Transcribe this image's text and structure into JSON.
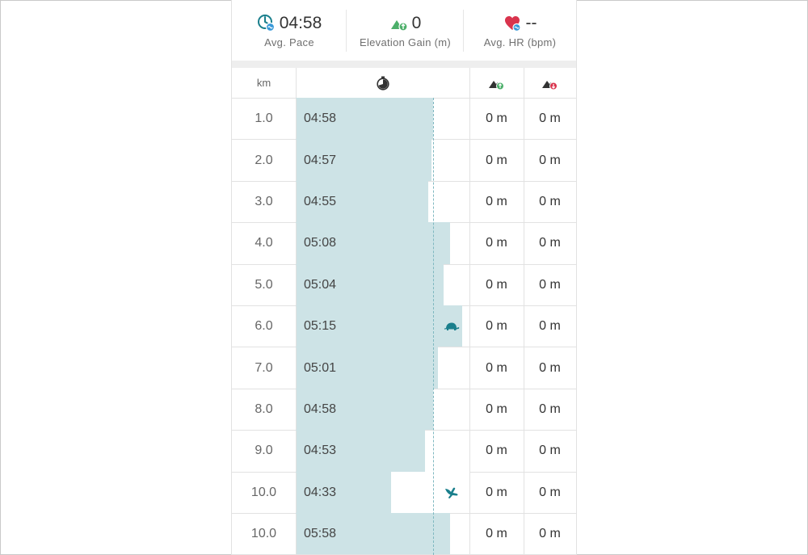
{
  "summary": {
    "avg_pace": {
      "value": "04:58",
      "label": "Avg. Pace",
      "icon": "pace-clock-icon"
    },
    "elevation_gain": {
      "value": "0",
      "label": "Elevation Gain (m)",
      "icon": "elevation-gain-icon"
    },
    "avg_hr": {
      "value": "--",
      "label": "Avg. HR (bpm)",
      "icon": "heart-rate-icon"
    }
  },
  "table": {
    "headers": {
      "km": "km",
      "pace_icon": "stopwatch-icon",
      "ascent_icon": "ascent-icon",
      "descent_icon": "descent-icon"
    },
    "avg_pace_seconds": 298,
    "rows": [
      {
        "km": "1.0",
        "pace": "04:58",
        "pace_seconds": 298,
        "ascent": "0 m",
        "descent": "0 m",
        "badge": ""
      },
      {
        "km": "2.0",
        "pace": "04:57",
        "pace_seconds": 297,
        "ascent": "0 m",
        "descent": "0 m",
        "badge": ""
      },
      {
        "km": "3.0",
        "pace": "04:55",
        "pace_seconds": 295,
        "ascent": "0 m",
        "descent": "0 m",
        "badge": ""
      },
      {
        "km": "4.0",
        "pace": "05:08",
        "pace_seconds": 308,
        "ascent": "0 m",
        "descent": "0 m",
        "badge": ""
      },
      {
        "km": "5.0",
        "pace": "05:04",
        "pace_seconds": 304,
        "ascent": "0 m",
        "descent": "0 m",
        "badge": ""
      },
      {
        "km": "6.0",
        "pace": "05:15",
        "pace_seconds": 315,
        "ascent": "0 m",
        "descent": "0 m",
        "badge": "slowest-turtle-icon"
      },
      {
        "km": "7.0",
        "pace": "05:01",
        "pace_seconds": 301,
        "ascent": "0 m",
        "descent": "0 m",
        "badge": ""
      },
      {
        "km": "8.0",
        "pace": "04:58",
        "pace_seconds": 298,
        "ascent": "0 m",
        "descent": "0 m",
        "badge": ""
      },
      {
        "km": "9.0",
        "pace": "04:53",
        "pace_seconds": 293,
        "ascent": "0 m",
        "descent": "0 m",
        "badge": ""
      },
      {
        "km": "10.0",
        "pace": "04:33",
        "pace_seconds": 273,
        "ascent": "0 m",
        "descent": "0 m",
        "badge": "fastest-bird-icon"
      },
      {
        "km": "10.0",
        "pace": "05:58",
        "pace_seconds": 308,
        "ascent": "0 m",
        "descent": "0 m",
        "badge": ""
      }
    ]
  },
  "colors": {
    "bar": "#cde3e6",
    "accent_teal": "#1a7f8c",
    "gain_green": "#4caf6a",
    "loss_red": "#d9344d",
    "heart_red": "#d9344d",
    "avg_line": "#7fb8c0"
  }
}
